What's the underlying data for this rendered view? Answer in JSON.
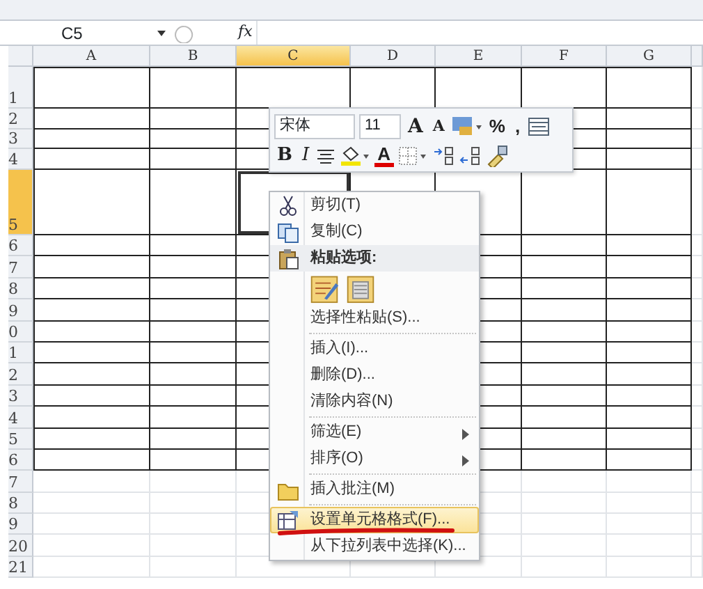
{
  "formula_bar": {
    "name_box": "C5",
    "formula_button": "fx"
  },
  "columns": [
    {
      "label": "A",
      "selected": false
    },
    {
      "label": "B",
      "selected": false
    },
    {
      "label": "C",
      "selected": true
    },
    {
      "label": "D",
      "selected": false
    },
    {
      "label": "E",
      "selected": false
    },
    {
      "label": "F",
      "selected": false
    },
    {
      "label": "G",
      "selected": false
    }
  ],
  "rows": [
    {
      "label": "1",
      "selected": false,
      "bordered": true
    },
    {
      "label": "2",
      "selected": false,
      "bordered": true
    },
    {
      "label": "3",
      "selected": false,
      "bordered": true
    },
    {
      "label": "4",
      "selected": false,
      "bordered": true
    },
    {
      "label": "5",
      "selected": true,
      "bordered": true
    },
    {
      "label": "6",
      "selected": false,
      "bordered": true
    },
    {
      "label": "7",
      "selected": false,
      "bordered": true
    },
    {
      "label": "8",
      "selected": false,
      "bordered": true
    },
    {
      "label": "9",
      "selected": false,
      "bordered": true
    },
    {
      "label": "0",
      "selected": false,
      "bordered": true
    },
    {
      "label": "1",
      "selected": false,
      "bordered": true
    },
    {
      "label": "2",
      "selected": false,
      "bordered": true
    },
    {
      "label": "3",
      "selected": false,
      "bordered": true
    },
    {
      "label": "4",
      "selected": false,
      "bordered": true
    },
    {
      "label": "5",
      "selected": false,
      "bordered": true
    },
    {
      "label": "6",
      "selected": false,
      "bordered": true
    },
    {
      "label": "7",
      "selected": false,
      "bordered": false
    },
    {
      "label": "8",
      "selected": false,
      "bordered": false
    },
    {
      "label": "9",
      "selected": false,
      "bordered": false
    },
    {
      "label": "20",
      "selected": false,
      "bordered": false
    },
    {
      "label": "21",
      "selected": false,
      "bordered": false
    }
  ],
  "mini_toolbar": {
    "row_1": [
      {
        "kind": "font",
        "value": "宋体"
      },
      {
        "kind": "size",
        "value": "11"
      },
      {
        "kind": "grow",
        "label": "A"
      },
      {
        "kind": "shrink",
        "label": "A"
      },
      {
        "kind": "style"
      },
      {
        "kind": "text",
        "label": "%"
      },
      {
        "kind": "text",
        "label": ","
      },
      {
        "kind": "merge"
      }
    ],
    "row_2": [
      {
        "kind": "bold",
        "label": "B"
      },
      {
        "kind": "italic",
        "label": "I"
      },
      {
        "kind": "align"
      },
      {
        "kind": "fill"
      },
      {
        "kind": "fontcolor",
        "label": "A"
      },
      {
        "kind": "border"
      },
      {
        "kind": "incdec"
      },
      {
        "kind": "decdec"
      },
      {
        "kind": "painter"
      }
    ]
  },
  "context_menu": [
    {
      "kind": "item",
      "label": "剪切(T)",
      "selected": false
    },
    {
      "kind": "item",
      "label": "复制(C)",
      "selected": false
    },
    {
      "kind": "header",
      "label": "粘贴选项:"
    },
    {
      "kind": "paste-options"
    },
    {
      "kind": "item",
      "label": "选择性粘贴(S)...",
      "selected": false
    },
    {
      "kind": "separator"
    },
    {
      "kind": "item",
      "label": "插入(I)...",
      "selected": false
    },
    {
      "kind": "item",
      "label": "删除(D)...",
      "selected": false
    },
    {
      "kind": "item",
      "label": "清除内容(N)",
      "selected": false
    },
    {
      "kind": "separator"
    },
    {
      "kind": "item",
      "label": "筛选(E)",
      "submenu": true,
      "selected": false
    },
    {
      "kind": "item",
      "label": "排序(O)",
      "submenu": true,
      "selected": false
    },
    {
      "kind": "separator"
    },
    {
      "kind": "item",
      "label": "插入批注(M)",
      "selected": false
    },
    {
      "kind": "separator"
    },
    {
      "kind": "item",
      "label": "设置单元格格式(F)...",
      "selected": true,
      "underlined": true
    },
    {
      "kind": "item",
      "label": "从下拉列表中选择(K)...",
      "selected": false
    }
  ]
}
